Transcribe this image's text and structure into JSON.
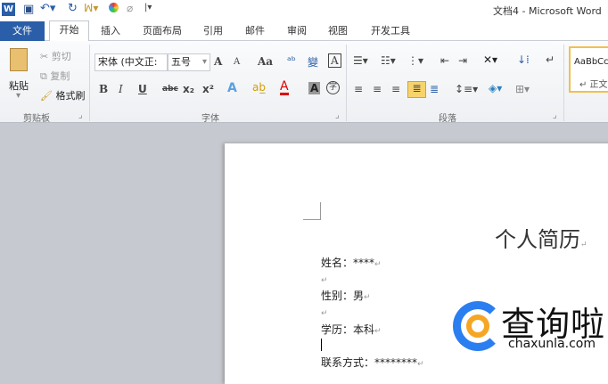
{
  "window": {
    "title": "文档4 - Microsoft Word"
  },
  "quick_access": {
    "icons": [
      "word-logo-icon",
      "save-icon",
      "undo-icon",
      "redo-icon",
      "format-icon",
      "color-icon",
      "clear-icon",
      "customize-icon"
    ]
  },
  "tabs": [
    "文件",
    "开始",
    "插入",
    "页面布局",
    "引用",
    "邮件",
    "审阅",
    "视图",
    "开发工具"
  ],
  "clipboard": {
    "paste": "粘贴",
    "cut": "剪切",
    "copy": "复制",
    "format_painter": "格式刷",
    "group": "剪贴板"
  },
  "font": {
    "name": "宋体 (中文正:",
    "size": "五号",
    "group": "字体",
    "bold": "B",
    "italic": "I",
    "underline": "U",
    "strike": "abc",
    "sub": "x₂",
    "sup": "x²",
    "grow": "A",
    "shrink": "A",
    "case": "Aa",
    "clear": "A",
    "border": "A",
    "shade": "A",
    "circle": "字"
  },
  "paragraph": {
    "group": "段落"
  },
  "styles": {
    "preview": "AaBbCc",
    "name": "↵ 正文"
  },
  "document": {
    "title": "个人简历",
    "lines": [
      "姓名：****",
      "",
      "性别：男",
      "",
      "学历：本科",
      "",
      "联系方式：********"
    ]
  },
  "watermark": {
    "text": "查询啦",
    "url": "chaxunla.com",
    "colors": {
      "blue": "#2b7ef0",
      "orange": "#f5a623"
    }
  },
  "colors": {
    "file_tab": "#2a5ea8",
    "highlight": "#f7d36b"
  }
}
